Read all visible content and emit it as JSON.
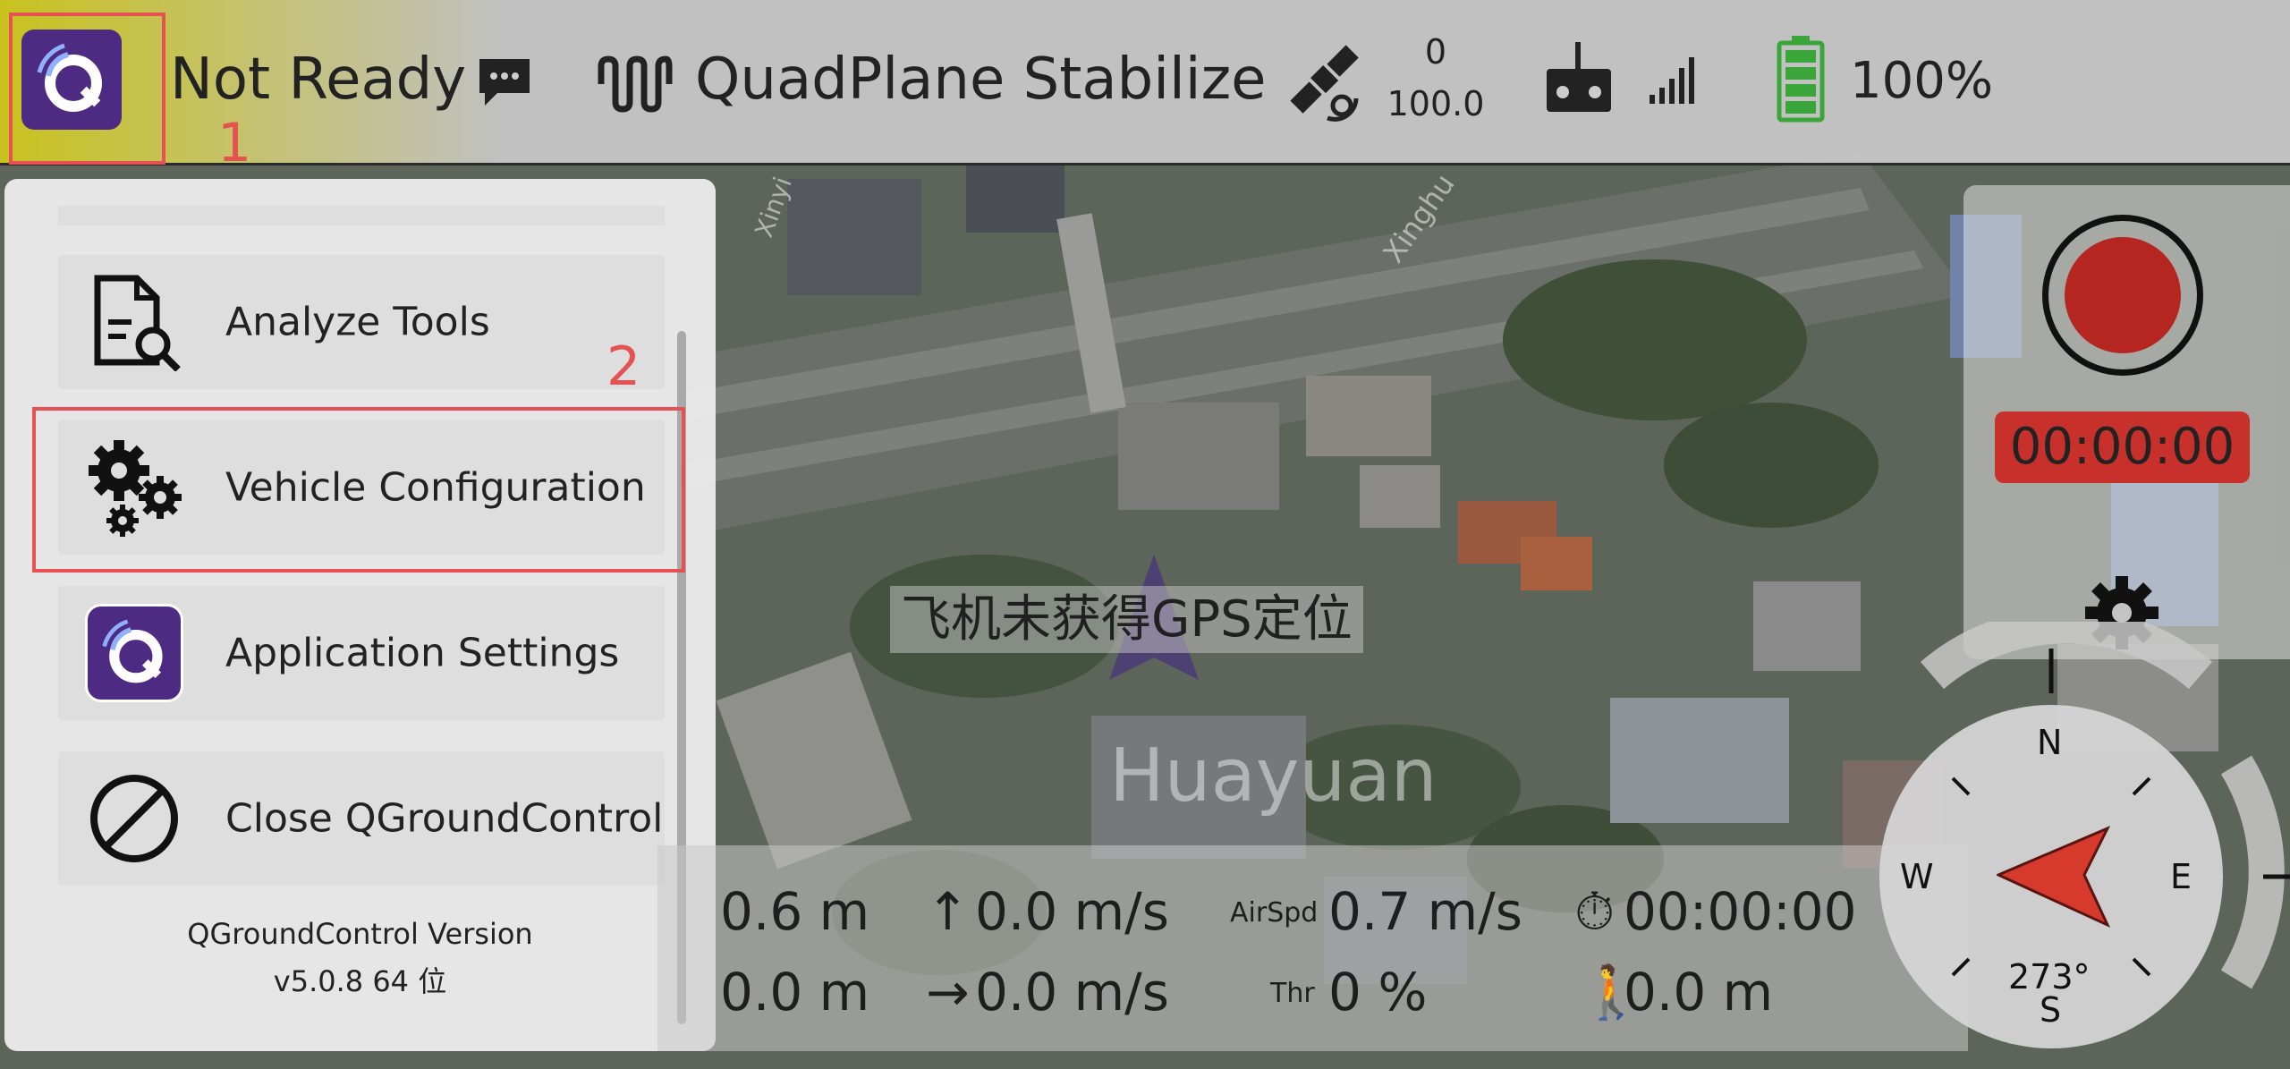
{
  "toolbar": {
    "status": "Not Ready",
    "flight_mode": "QuadPlane Stabilize",
    "gps_count": "0",
    "gps_hdop": "100.0",
    "battery": "100%",
    "battery_level": 1.0
  },
  "annotations": {
    "first": "1",
    "second": "2"
  },
  "drawer": {
    "items": [
      {
        "label": "Analyze Tools",
        "icon": "analyze-icon"
      },
      {
        "label": "Vehicle Configuration",
        "icon": "gears-icon"
      },
      {
        "label": "Application Settings",
        "icon": "qgc-logo-icon"
      },
      {
        "label": "Close QGroundControl",
        "icon": "prohibit-icon"
      }
    ],
    "version_label": "QGroundControl Version",
    "version_value": "v5.0.8 64 位"
  },
  "map": {
    "gps_message": "飞机未获得GPS定位",
    "place_label": "Huayuan",
    "road_label_1": "Xinyi",
    "road_label_2": "Xinghu"
  },
  "telemetry": {
    "altitude": "0.6 m",
    "climb_rate": "0.0 m/s",
    "airspeed_label": "AirSpd",
    "airspeed": "0.7 m/s",
    "flight_time": "00:00:00",
    "distance": "0.0 m",
    "ground_speed": "0.0 m/s",
    "throttle_label": "Thr",
    "throttle": "0 %",
    "distance_to_home": "0.0 m"
  },
  "recording": {
    "time": "00:00:00"
  },
  "compass": {
    "north": "N",
    "east": "E",
    "south": "S",
    "west": "W",
    "heading": "273°"
  },
  "colors": {
    "accent_red": "#e65252",
    "record_red": "#b52621",
    "battery_green": "#3aa63a",
    "qgc_purple": "#5b2d8e"
  }
}
